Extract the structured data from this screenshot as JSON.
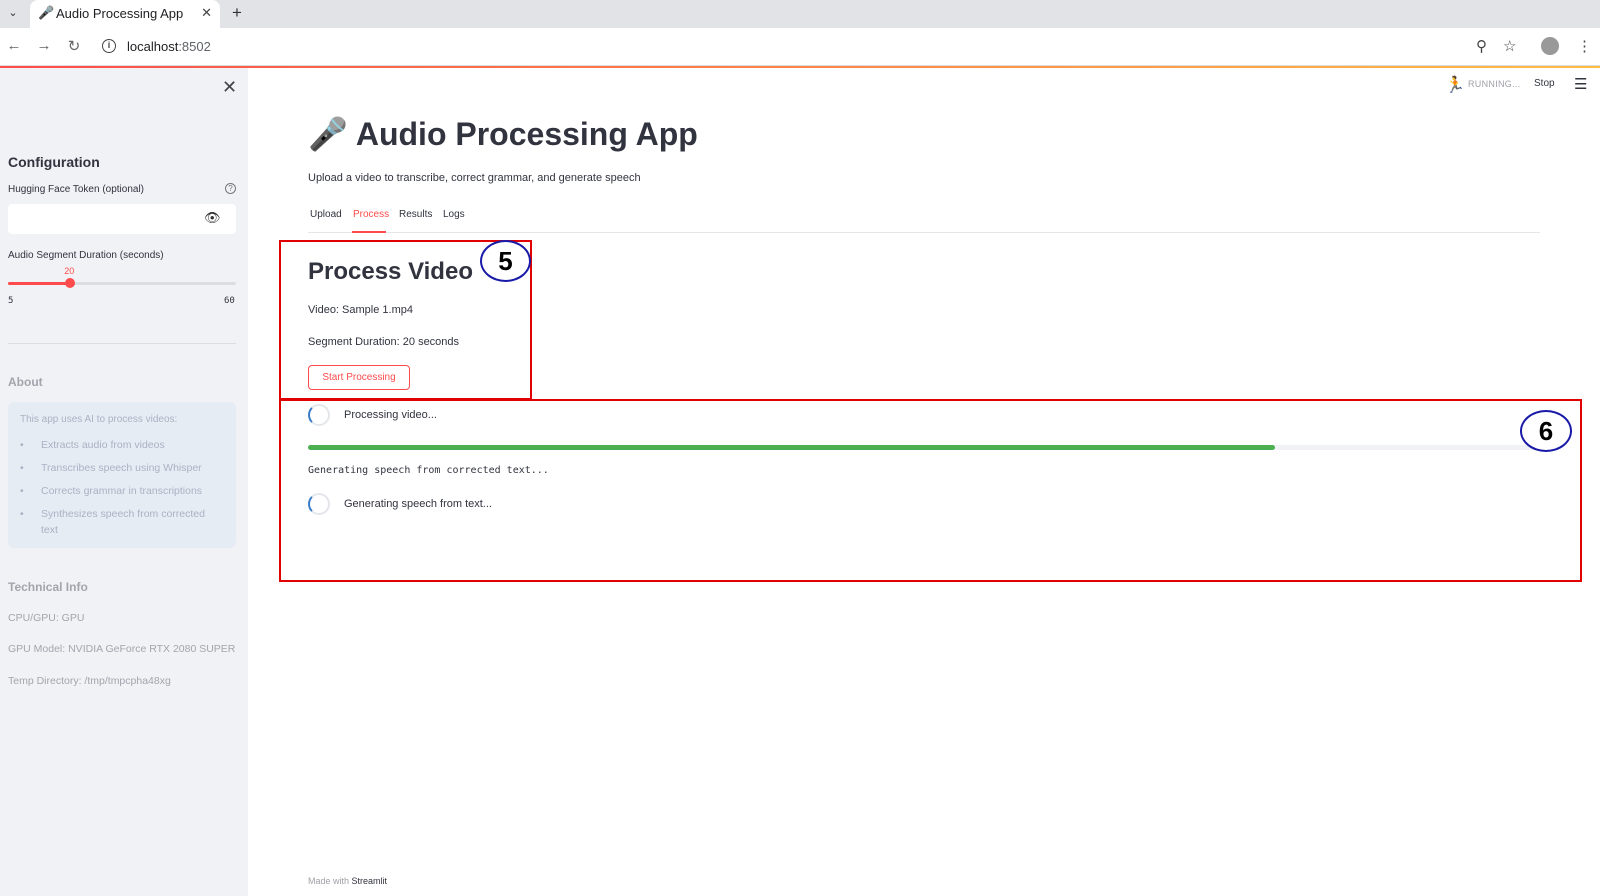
{
  "browser": {
    "tab_title": "Audio Processing App",
    "tab_favicon": "🎤",
    "url_host": "localhost",
    "url_port": ":8502"
  },
  "header": {
    "running_label": "RUNNING...",
    "stop_label": "Stop"
  },
  "sidebar": {
    "heading": "Configuration",
    "token_label": "Hugging Face Token (optional)",
    "token_value": "",
    "segment_label": "Audio Segment Duration (seconds)",
    "slider": {
      "value": "20",
      "min": "5",
      "max": "60",
      "value_fraction": 0.273
    },
    "about_heading": "About",
    "about_intro": "This app uses AI to process videos:",
    "about_items": [
      "Extracts audio from videos",
      "Transcribes speech using Whisper",
      "Corrects grammar in transcriptions",
      "Synthesizes speech from corrected text"
    ],
    "tech_heading": "Technical Info",
    "tech_items": [
      "CPU/GPU: GPU",
      "GPU Model: NVIDIA GeForce RTX 2080 SUPER",
      "Temp Directory: /tmp/tmpcpha48xg"
    ]
  },
  "main": {
    "title": "Audio Processing App",
    "title_icon": "🎤",
    "subtitle": "Upload a video to transcribe, correct grammar, and generate speech",
    "tabs": [
      {
        "label": "Upload",
        "active": false
      },
      {
        "label": "Process",
        "active": true
      },
      {
        "label": "Results",
        "active": false
      },
      {
        "label": "Logs",
        "active": false
      }
    ],
    "section_title": "Process Video",
    "video_line": "Video: Sample 1.mp4",
    "duration_line": "Segment Duration: 20 seconds",
    "start_button": "Start Processing",
    "status_1": "Processing video...",
    "progress_fraction": 0.785,
    "progress_message": "Generating speech from corrected text...",
    "status_2": "Generating speech from text..."
  },
  "annotations": {
    "badge_5": "5",
    "badge_6": "6"
  },
  "footer": {
    "prefix": "Made with",
    "brand": "Streamlit"
  },
  "colors": {
    "accent": "#ff4b4b",
    "progress": "#4caf50",
    "annotation_box": "#e00000",
    "annotation_badge": "#1a1aa8"
  }
}
